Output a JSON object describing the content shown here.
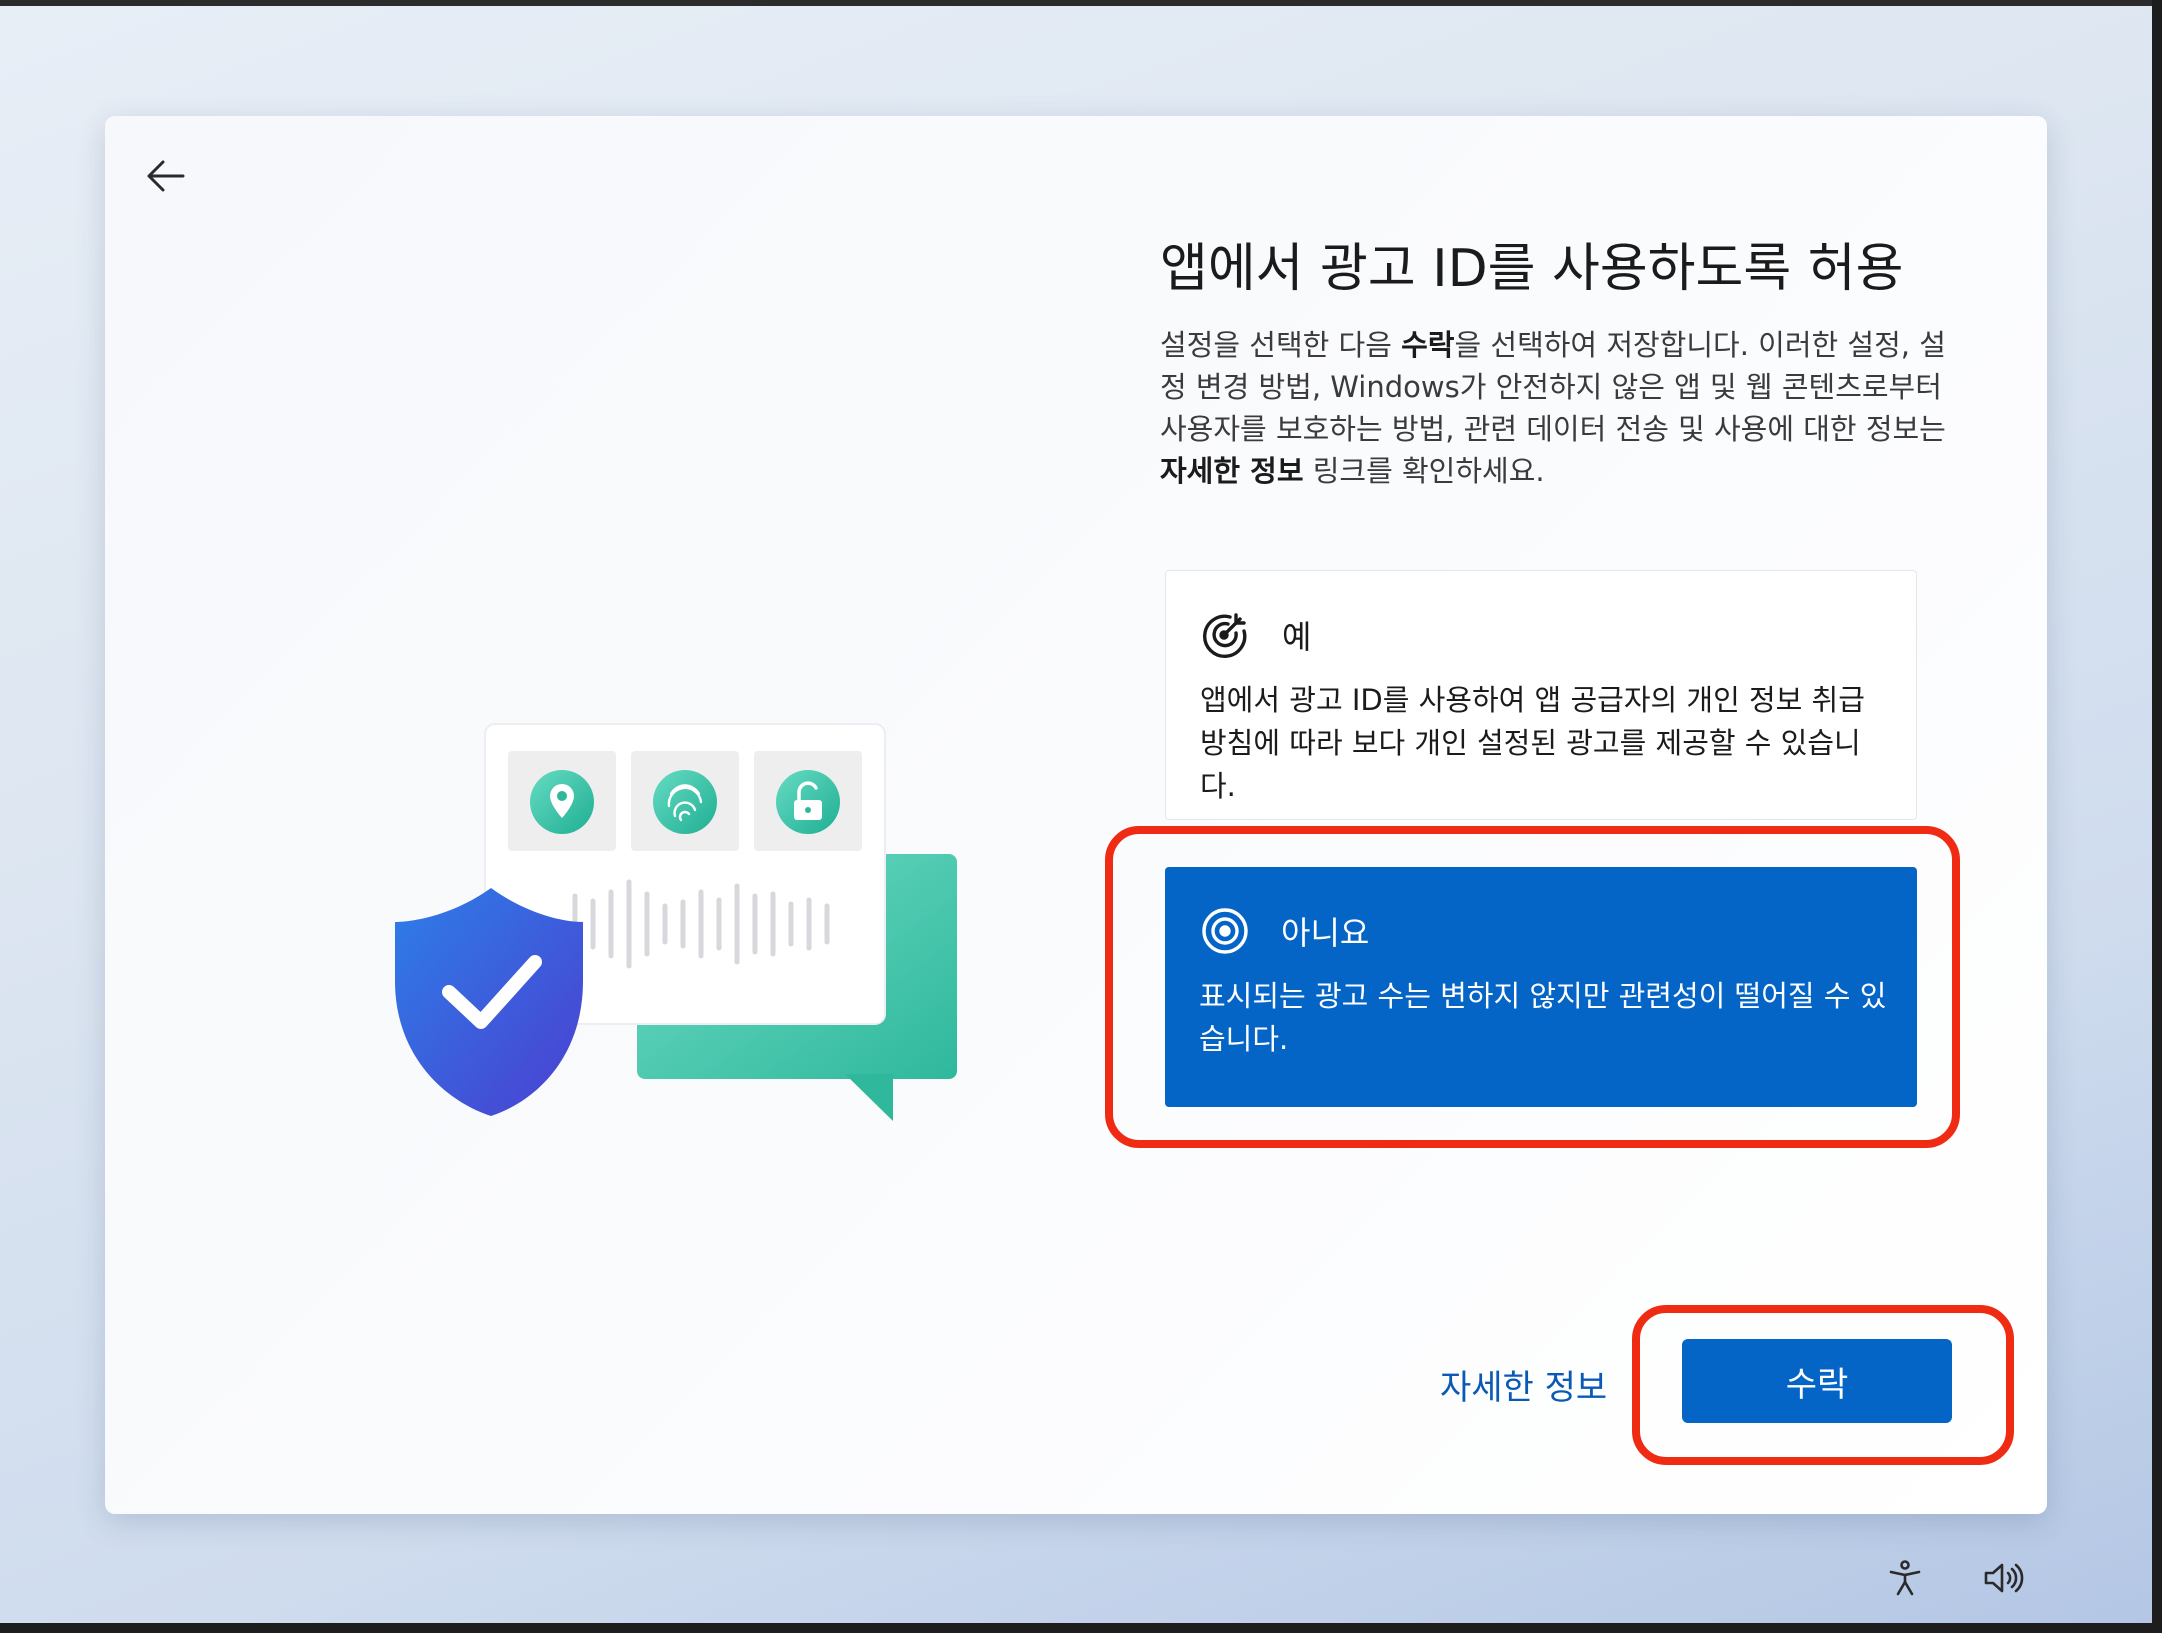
{
  "header": {
    "back_icon": "arrow-left-icon"
  },
  "main": {
    "title": "앱에서 광고 ID를 사용하도록 허용",
    "description_part1": "설정을 선택한 다음 ",
    "description_bold1": "수락",
    "description_part2": "을 선택하여 저장합니다. 이러한 설정, 설정 변경 방법, Windows가 안전하지 않은 앱 및 웹 콘텐츠로부터 사용자를 보호하는 방법, 관련 데이터 전송 및 사용에 대한 정보는 ",
    "description_bold2": "자세한 정보",
    "description_part3": " 링크를 확인하세요."
  },
  "options": [
    {
      "label": "예",
      "description": "앱에서 광고 ID를 사용하여 앱 공급자의 개인 정보 취급 방침에 따라 보다 개인 설정된 광고를 제공할 수 있습니다.",
      "icon": "target-icon",
      "selected": false
    },
    {
      "label": "아니요",
      "description": "표시되는 광고 수는 변하지 않지만 관련성이 떨어질 수 있습니다.",
      "icon": "target-off-icon",
      "selected": true
    }
  ],
  "footer": {
    "learn_more_label": "자세한 정보",
    "accept_label": "수락"
  },
  "system_tray": {
    "accessibility_icon": "accessibility-icon",
    "volume_icon": "volume-icon"
  },
  "colors": {
    "accent": "#0465c7",
    "link": "#0a5ab5",
    "highlight": "#ef2b14",
    "illustration_teal": "#3cc4a8",
    "shield_blue": "#3a4fd6"
  }
}
